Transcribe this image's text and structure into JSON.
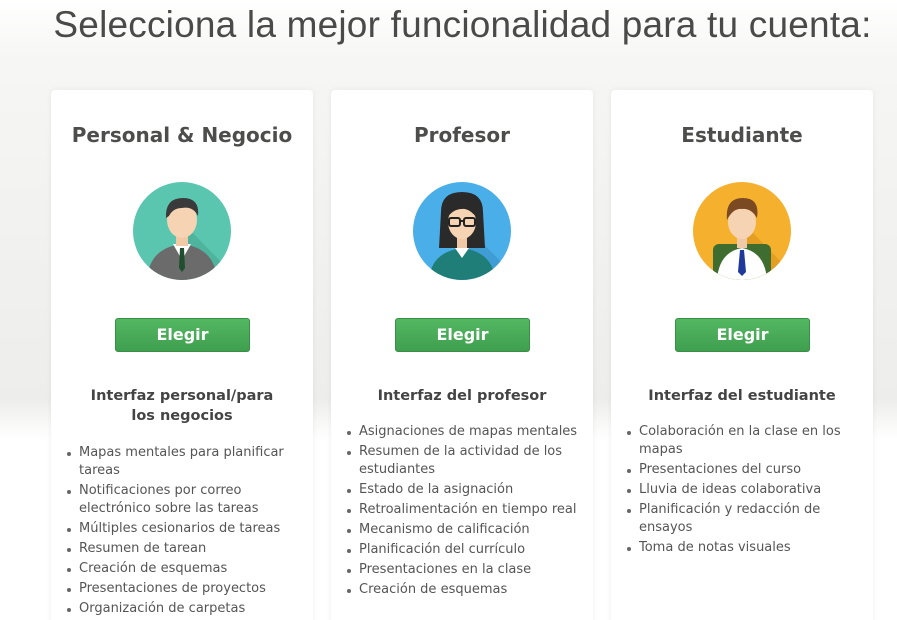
{
  "page": {
    "title": "Selecciona la mejor funcionalidad para tu cuenta:"
  },
  "plans": [
    {
      "title": "Personal & Negocio",
      "avatar_icon": "businessman-avatar-icon",
      "avatar_bg": "#5bc6b0",
      "button_label": "Elegir",
      "features_heading": "Interfaz personal/para los negocios",
      "features": [
        "Mapas mentales para planificar tareas",
        "Notificaciones por correo electrónico sobre las tareas",
        "Múltiples cesionarios de tareas",
        "Resumen de tarean",
        "Creación de esquemas",
        "Presentaciones de proyectos",
        "Organización de carpetas"
      ]
    },
    {
      "title": "Profesor",
      "avatar_icon": "teacher-avatar-icon",
      "avatar_bg": "#4aaee8",
      "button_label": "Elegir",
      "features_heading": "Interfaz del profesor",
      "features": [
        "Asignaciones de mapas mentales",
        "Resumen de la actividad de los estudiantes",
        "Estado de la asignación",
        "Retroalimentación en tiempo real",
        "Mecanismo de calificación",
        "Planificación del currículo",
        "Presentaciones en la clase",
        "Creación de esquemas"
      ]
    },
    {
      "title": "Estudiante",
      "avatar_icon": "student-avatar-icon",
      "avatar_bg": "#f5b02e",
      "button_label": "Elegir",
      "features_heading": "Interfaz del estudiante",
      "features": [
        "Colaboración en la clase en los mapas",
        "Presentaciones del curso",
        "Lluvia de ideas colaborativa",
        "Planificación y redacción de ensayos",
        "Toma de notas visuales"
      ]
    }
  ],
  "colors": {
    "button_green": "#45a855",
    "title_text": "#4a4a48"
  }
}
